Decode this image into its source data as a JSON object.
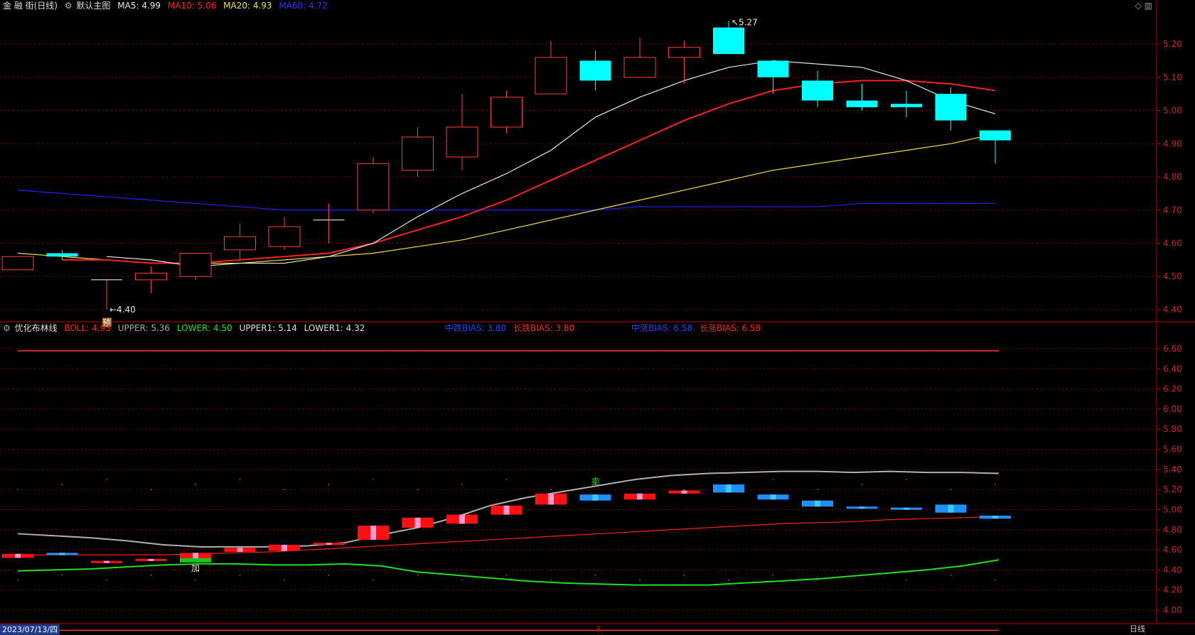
{
  "main_header": {
    "stock": "金 融 街(日线)",
    "icon": "gear-icon",
    "title": "默认主图",
    "ma5": "MA5: 4.99",
    "ma10": "MA10: 5.06",
    "ma20": "MA20: 4.93",
    "ma60": "MA60: 4.72"
  },
  "sub_header": {
    "icon": "gear-icon",
    "title": "优化布林线",
    "boll": "BOLL: 4.93",
    "upper": "UPPER: 5.36",
    "lower": "LOWER: 4.50",
    "upper1": "UPPER1: 5.14",
    "lower1": "LOWER1: 4.32",
    "bias1": "中跌BIAS: 3.80",
    "bias2": "长跌BIAS: 3.80",
    "bias3": "中涨BIAS: 6.58",
    "bias4": "长涨BIAS: 6.58"
  },
  "footer": {
    "date": "2023/07/13/四",
    "mid_tag": "8",
    "period": "日线"
  },
  "colors": {
    "up": "#ff3b3b",
    "down": "#00ffff",
    "ma5": "#e8e8e8",
    "ma10": "#ff2020",
    "ma20": "#f0e040",
    "ma60": "#2020ff",
    "grid": "#7a0000",
    "axis": "#c00000"
  },
  "chart_data": [
    {
      "type": "candlestick",
      "yticks": [
        "5.20",
        "5.10",
        "5.00",
        "4.90",
        "4.80",
        "4.70",
        "4.60",
        "4.50",
        "4.40"
      ],
      "ylim": [
        4.37,
        5.29
      ],
      "ohlc": [
        [
          4.52,
          4.56,
          4.52,
          4.56
        ],
        [
          4.57,
          4.58,
          4.55,
          4.56
        ],
        [
          4.49,
          4.49,
          4.4,
          4.49
        ],
        [
          4.49,
          4.53,
          4.45,
          4.51
        ],
        [
          4.5,
          4.57,
          4.49,
          4.57
        ],
        [
          4.58,
          4.66,
          4.55,
          4.62
        ],
        [
          4.59,
          4.68,
          4.58,
          4.65
        ],
        [
          4.67,
          4.72,
          4.6,
          4.67
        ],
        [
          4.7,
          4.86,
          4.69,
          4.84
        ],
        [
          4.82,
          4.95,
          4.8,
          4.92
        ],
        [
          4.86,
          5.05,
          4.82,
          4.95
        ],
        [
          4.95,
          5.06,
          4.93,
          5.04
        ],
        [
          5.05,
          5.21,
          5.05,
          5.16
        ],
        [
          5.15,
          5.18,
          5.06,
          5.09
        ],
        [
          5.1,
          5.22,
          5.1,
          5.16
        ],
        [
          5.16,
          5.21,
          5.08,
          5.19
        ],
        [
          5.25,
          5.27,
          5.17,
          5.17
        ],
        [
          5.15,
          5.15,
          5.05,
          5.1
        ],
        [
          5.09,
          5.12,
          5.01,
          5.03
        ],
        [
          5.03,
          5.08,
          5.0,
          5.01
        ],
        [
          5.02,
          5.06,
          4.98,
          5.01
        ],
        [
          5.05,
          5.07,
          4.94,
          4.97
        ],
        [
          4.94,
          4.94,
          4.84,
          4.91
        ]
      ],
      "ma5": [
        4.56,
        4.55,
        4.53,
        4.54,
        4.54,
        4.56,
        4.6,
        4.68,
        4.75,
        4.81,
        4.88,
        4.98,
        5.04,
        5.09,
        5.13,
        5.15,
        5.14,
        5.13,
        5.09,
        5.03,
        4.99
      ],
      "ma10": [
        4.55,
        4.55,
        4.54,
        4.54,
        4.55,
        4.56,
        4.57,
        4.6,
        4.64,
        4.68,
        4.73,
        4.79,
        4.85,
        4.91,
        4.97,
        5.02,
        5.06,
        5.08,
        5.09,
        5.09,
        5.08,
        5.06
      ],
      "ma20": [
        4.57,
        4.56,
        4.55,
        4.54,
        4.54,
        4.54,
        4.55,
        4.56,
        4.57,
        4.59,
        4.61,
        4.64,
        4.67,
        4.7,
        4.73,
        4.76,
        4.79,
        4.82,
        4.84,
        4.86,
        4.88,
        4.9,
        4.93
      ],
      "ma60": [
        4.76,
        4.75,
        4.74,
        4.73,
        4.72,
        4.71,
        4.7,
        4.7,
        4.7,
        4.7,
        4.7,
        4.7,
        4.7,
        4.7,
        4.71,
        4.71,
        4.71,
        4.71,
        4.71,
        4.72,
        4.72,
        4.72,
        4.72
      ],
      "annotations": [
        {
          "label": "5.27",
          "index": 16,
          "value": 5.27
        },
        {
          "label": "4.40",
          "index": 2,
          "value": 4.4
        },
        {
          "label": "预",
          "index": 2,
          "value": 4.38
        }
      ]
    },
    {
      "type": "bollinger",
      "yticks": [
        "6.60",
        "6.40",
        "6.20",
        "6.00",
        "5.80",
        "5.60",
        "5.40",
        "5.20",
        "5.00",
        "4.80",
        "4.60",
        "4.40",
        "4.20",
        "4.00"
      ],
      "ylim": [
        3.88,
        6.72
      ],
      "upper_line": 6.58,
      "lower_line": 3.8,
      "upper": [
        4.76,
        4.74,
        4.72,
        4.69,
        4.65,
        4.63,
        4.63,
        4.63,
        4.64,
        4.67,
        4.75,
        4.82,
        4.92,
        5.04,
        5.12,
        5.18,
        5.24,
        5.3,
        5.34,
        5.36,
        5.37,
        5.38,
        5.38,
        5.37,
        5.38,
        5.37,
        5.37,
        5.36
      ],
      "boll": [
        4.55,
        4.55,
        4.55,
        4.55,
        4.55,
        4.56,
        4.57,
        4.58,
        4.6,
        4.62,
        4.64,
        4.66,
        4.68,
        4.7,
        4.72,
        4.74,
        4.76,
        4.78,
        4.8,
        4.82,
        4.84,
        4.86,
        4.87,
        4.88,
        4.9,
        4.91,
        4.92,
        4.93
      ],
      "lower": [
        4.39,
        4.4,
        4.41,
        4.43,
        4.45,
        4.46,
        4.46,
        4.45,
        4.45,
        4.46,
        4.44,
        4.38,
        4.35,
        4.32,
        4.29,
        4.27,
        4.26,
        4.25,
        4.25,
        4.25,
        4.27,
        4.29,
        4.31,
        4.34,
        4.37,
        4.4,
        4.44,
        4.5
      ],
      "annotations": [
        {
          "label": "卖",
          "index": 13,
          "value": 5.28
        },
        {
          "label": "加",
          "index": 4,
          "value": 4.46
        }
      ]
    }
  ]
}
